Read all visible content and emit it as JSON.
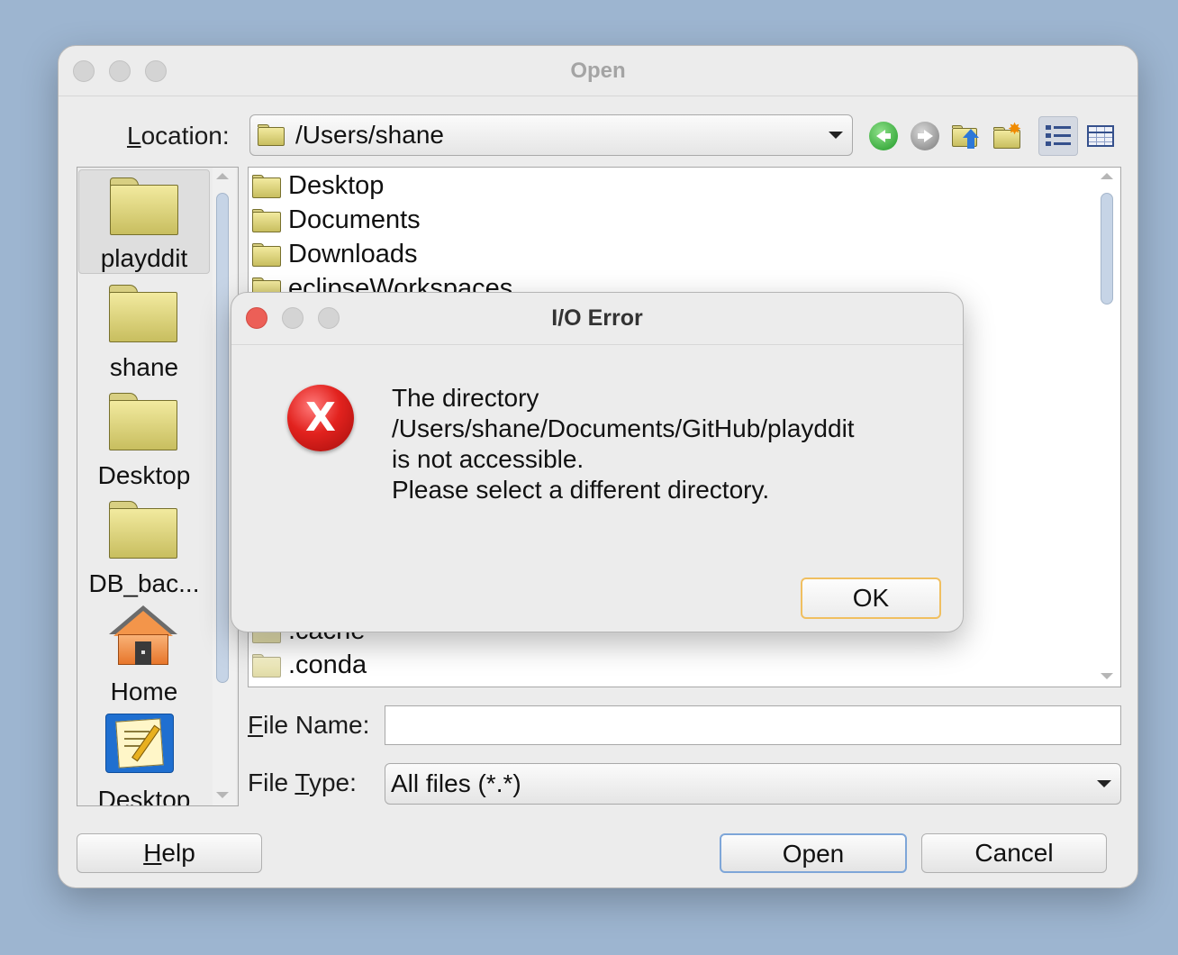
{
  "window": {
    "title": "Open"
  },
  "location": {
    "label_u": "L",
    "label_rest": "ocation:",
    "path": "/Users/shane"
  },
  "toolbar": {
    "back": "back-icon",
    "forward": "forward-icon",
    "up": "up-folder-icon",
    "new_folder": "new-folder-icon",
    "list_view": "list-view-icon",
    "details_view": "details-view-icon"
  },
  "places": [
    {
      "label": "playddit",
      "icon": "folder-icon",
      "selected": true
    },
    {
      "label": "shane",
      "icon": "folder-icon"
    },
    {
      "label": "Desktop",
      "icon": "folder-icon"
    },
    {
      "label": "DB_bac...",
      "icon": "folder-icon"
    },
    {
      "label": "Home",
      "icon": "home-icon"
    },
    {
      "label": "Desktop",
      "icon": "desktop-doc-icon"
    }
  ],
  "files": [
    {
      "name": "Desktop"
    },
    {
      "name": "Documents"
    },
    {
      "name": "Downloads"
    },
    {
      "name": "eclipseWorkspaces"
    },
    {
      "name": ".cache",
      "hidden": true
    },
    {
      "name": ".conda",
      "hidden": true
    }
  ],
  "file_name": {
    "label_u": "F",
    "label_rest": "ile Name:",
    "value": ""
  },
  "file_type": {
    "label_pre": "File ",
    "label_u": "T",
    "label_rest": "ype:",
    "value": "All files (*.*)"
  },
  "buttons": {
    "help_u": "H",
    "help_rest": "elp",
    "open": "Open",
    "cancel": "Cancel"
  },
  "error_dialog": {
    "title": "I/O Error",
    "lines": [
      "The directory",
      "/Users/shane/Documents/GitHub/playddit",
      "is not accessible.",
      "Please select a different directory."
    ],
    "ok": "OK"
  },
  "colors": {
    "accent_focus": "#f0bf60",
    "error": "#e2221e",
    "default_button": "#7ea6d8"
  }
}
